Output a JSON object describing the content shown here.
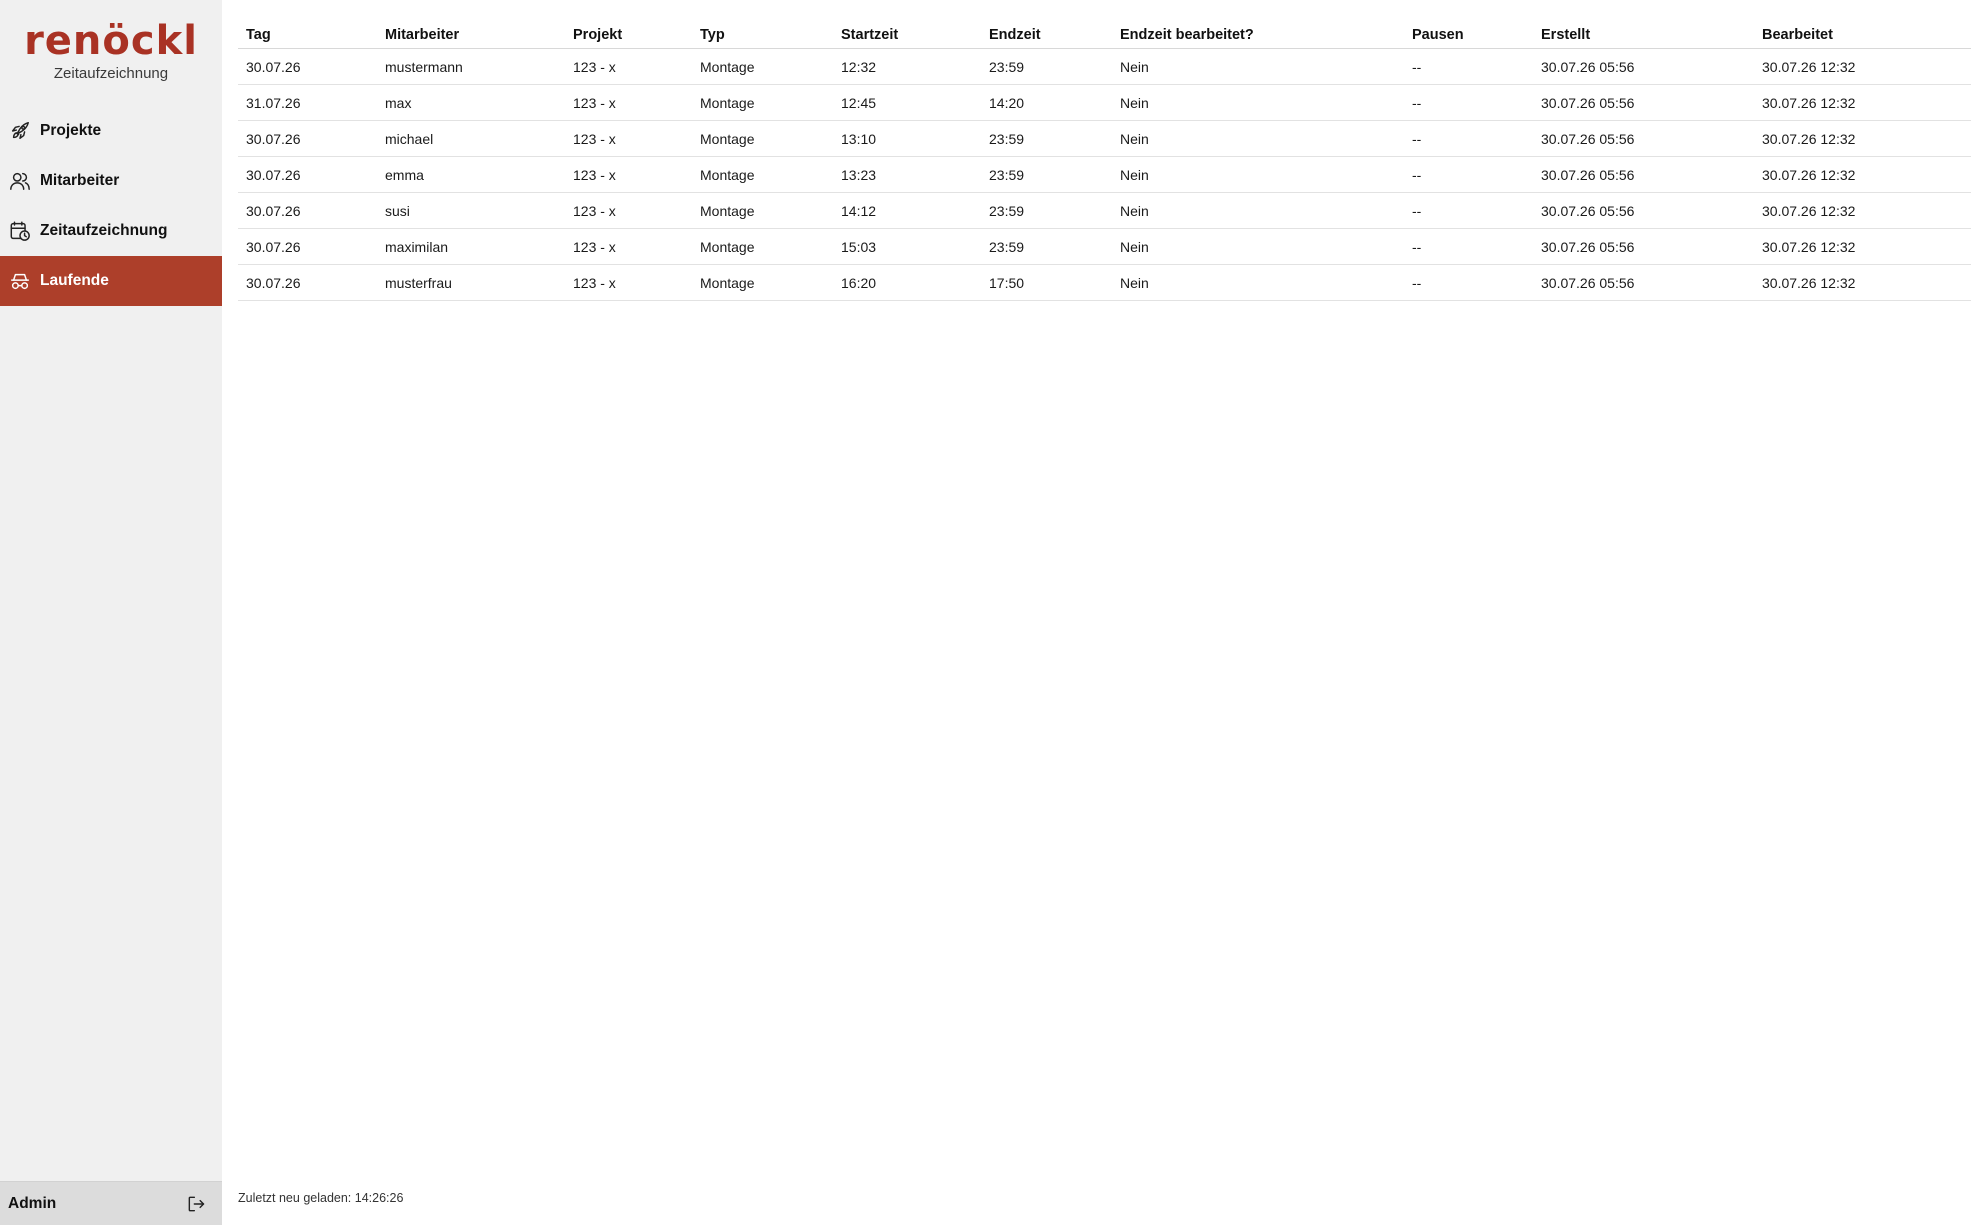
{
  "brand": {
    "logo_text": "renöckl",
    "subtitle": "Zeitaufzeichnung"
  },
  "theme": {
    "accent": "#ad3f2a",
    "logo": "#a93224",
    "sidebar_bg": "#f0f0f0"
  },
  "sidebar": {
    "items": [
      {
        "label": "Projekte",
        "icon": "rocket-icon"
      },
      {
        "label": "Mitarbeiter",
        "icon": "users-icon"
      },
      {
        "label": "Zeitaufzeichnung",
        "icon": "calendar-clock-icon"
      },
      {
        "label": "Laufende",
        "icon": "spy-icon",
        "active": true
      }
    ],
    "footer": {
      "user": "Admin",
      "logout_icon": "logout-icon"
    }
  },
  "table": {
    "headers": [
      "Tag",
      "Mitarbeiter",
      "Projekt",
      "Typ",
      "Startzeit",
      "Endzeit",
      "Endzeit bearbeitet?",
      "Pausen",
      "Erstellt",
      "Bearbeitet"
    ],
    "rows": [
      [
        "30.07.26",
        "mustermann",
        "123 - x",
        "Montage",
        "12:32",
        "23:59",
        "Nein",
        "--",
        "30.07.26 05:56",
        "30.07.26 12:32"
      ],
      [
        "31.07.26",
        "max",
        "123 - x",
        "Montage",
        "12:45",
        "14:20",
        "Nein",
        "--",
        "30.07.26 05:56",
        "30.07.26 12:32"
      ],
      [
        "30.07.26",
        "michael",
        "123 - x",
        "Montage",
        "13:10",
        "23:59",
        "Nein",
        "--",
        "30.07.26 05:56",
        "30.07.26 12:32"
      ],
      [
        "30.07.26",
        "emma",
        "123 - x",
        "Montage",
        "13:23",
        "23:59",
        "Nein",
        "--",
        "30.07.26 05:56",
        "30.07.26 12:32"
      ],
      [
        "30.07.26",
        "susi",
        "123 - x",
        "Montage",
        "14:12",
        "23:59",
        "Nein",
        "--",
        "30.07.26 05:56",
        "30.07.26 12:32"
      ],
      [
        "30.07.26",
        "maximilan",
        "123 - x",
        "Montage",
        "15:03",
        "23:59",
        "Nein",
        "--",
        "30.07.26 05:56",
        "30.07.26 12:32"
      ],
      [
        "30.07.26",
        "musterfrau",
        "123 - x",
        "Montage",
        "16:20",
        "17:50",
        "Nein",
        "--",
        "30.07.26 05:56",
        "30.07.26 12:32"
      ]
    ]
  },
  "status": {
    "last_reload": "Zuletzt neu geladen: 14:26:26"
  }
}
